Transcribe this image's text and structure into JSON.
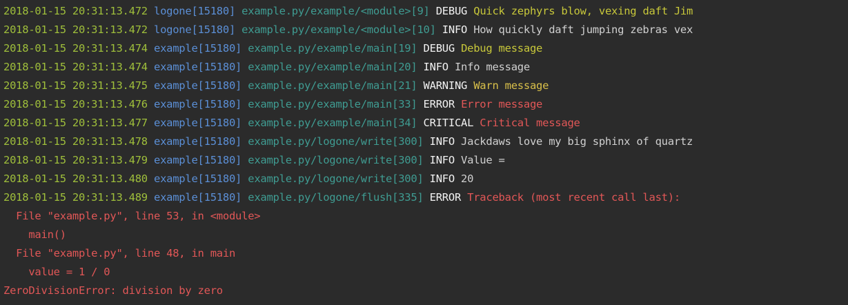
{
  "colors": {
    "background": "#2b2b2b",
    "timestamp": "#9fbf3b",
    "logger_name": "#5b8fd6",
    "location": "#3f9c92",
    "level": "#f2f2f2",
    "debug_message": "#c8c83a",
    "info_message": "#d0d0d0",
    "warning_message": "#d9c04a",
    "error_message": "#e25757"
  },
  "log": [
    {
      "ts": "2018-01-15 20:31:13.472",
      "name": "logone[15180]",
      "loc": "example.py/example/<module>[9]",
      "level": "DEBUG",
      "msg": "Quick zephyrs blow, vexing daft Jim",
      "kind": "debug"
    },
    {
      "ts": "2018-01-15 20:31:13.472",
      "name": "logone[15180]",
      "loc": "example.py/example/<module>[10]",
      "level": "INFO",
      "msg": "How quickly daft jumping zebras vex",
      "kind": "info"
    },
    {
      "ts": "2018-01-15 20:31:13.474",
      "name": "example[15180]",
      "loc": "example.py/example/main[19]",
      "level": "DEBUG",
      "msg": "Debug message",
      "kind": "debug"
    },
    {
      "ts": "2018-01-15 20:31:13.474",
      "name": "example[15180]",
      "loc": "example.py/example/main[20]",
      "level": "INFO",
      "msg": "Info message",
      "kind": "info"
    },
    {
      "ts": "2018-01-15 20:31:13.475",
      "name": "example[15180]",
      "loc": "example.py/example/main[21]",
      "level": "WARNING",
      "msg": "Warn message",
      "kind": "warning"
    },
    {
      "ts": "2018-01-15 20:31:13.476",
      "name": "example[15180]",
      "loc": "example.py/example/main[33]",
      "level": "ERROR",
      "msg": "Error message",
      "kind": "error"
    },
    {
      "ts": "2018-01-15 20:31:13.477",
      "name": "example[15180]",
      "loc": "example.py/example/main[34]",
      "level": "CRITICAL",
      "msg": "Critical message",
      "kind": "critical"
    },
    {
      "ts": "2018-01-15 20:31:13.478",
      "name": "example[15180]",
      "loc": "example.py/logone/write[300]",
      "level": "INFO",
      "msg": "Jackdaws love my big sphinx of quartz",
      "kind": "info"
    },
    {
      "ts": "2018-01-15 20:31:13.479",
      "name": "example[15180]",
      "loc": "example.py/logone/write[300]",
      "level": "INFO",
      "msg": "Value =",
      "kind": "info"
    },
    {
      "ts": "2018-01-15 20:31:13.480",
      "name": "example[15180]",
      "loc": "example.py/logone/write[300]",
      "level": "INFO",
      "msg": "20",
      "kind": "info"
    },
    {
      "ts": "2018-01-15 20:31:13.489",
      "name": "example[15180]",
      "loc": "example.py/logone/flush[335]",
      "level": "ERROR",
      "msg": "Traceback (most recent call last):",
      "kind": "error"
    }
  ],
  "traceback": [
    "  File \"example.py\", line 53, in <module>",
    "    main()",
    "  File \"example.py\", line 48, in main",
    "    value = 1 / 0",
    "ZeroDivisionError: division by zero"
  ]
}
